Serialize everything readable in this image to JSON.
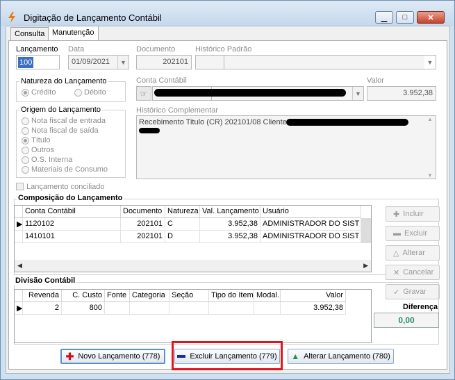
{
  "window": {
    "title": "Digitação de Lançamento Contábil",
    "controls": {
      "minimize": "▁",
      "maximize": "□",
      "close": "✕"
    }
  },
  "tabs": [
    {
      "label": "Consulta"
    },
    {
      "label": "Manutenção"
    }
  ],
  "header": {
    "lancamento_label": "Lançamento",
    "lancamento_value": "100",
    "data_label": "Data",
    "data_value": "01/09/2021",
    "documento_label": "Documento",
    "documento_value": "202101",
    "historico_padrao_label": "Histórico Padrão",
    "historico_padrao_value": ""
  },
  "natureza": {
    "title": "Natureza do Lançamento",
    "options": [
      "Crédito",
      "Débito"
    ],
    "selected": "Crédito"
  },
  "conta": {
    "label": "Conta Contábil",
    "valor_label": "Valor",
    "valor_value": "3.952,38"
  },
  "origem": {
    "title": "Origem do Lançamento",
    "options": [
      "Nota fiscal de entrada",
      "Nota fiscal de saída",
      "Título",
      "Outros",
      "O.S. Interna",
      "Materiais de Consumo"
    ],
    "selected": "Título"
  },
  "historico_complementar": {
    "label": "Histórico Complementar",
    "text": "Recebimento Titulo (CR) 202101/08 Cliente A"
  },
  "conciliado": {
    "label": "Lançamento conciliado",
    "checked": false
  },
  "composicao": {
    "title": "Composição do Lançamento",
    "columns": [
      "Conta Contábil",
      "Documento",
      "Natureza",
      "Val. Lançamento",
      "Usuário"
    ],
    "rows": [
      [
        "1120102",
        "202101",
        "C",
        "3.952,38",
        "ADMINISTRADOR DO SIST"
      ],
      [
        "1410101",
        "202101",
        "D",
        "3.952,38",
        "ADMINISTRADOR DO SIST"
      ]
    ]
  },
  "side_buttons": [
    {
      "label": "Incluir",
      "icon": "plus-icon"
    },
    {
      "label": "Excluir",
      "icon": "minus-icon"
    },
    {
      "label": "Alterar",
      "icon": "triangle-up-icon"
    },
    {
      "label": "Cancelar",
      "icon": "cross-icon"
    },
    {
      "label": "Gravar",
      "icon": "check-icon"
    }
  ],
  "divisao": {
    "title": "Divisão Contábil",
    "columns": [
      "Revenda",
      "C. Custo",
      "Fonte",
      "Categoria",
      "Seção",
      "Tipo do Item",
      "Modal.",
      "Valor"
    ],
    "rows": [
      [
        "2",
        "800",
        "",
        "",
        "",
        "",
        "",
        "3.952,38"
      ]
    ]
  },
  "diferenca": {
    "label": "Diferença",
    "value": "0,00"
  },
  "bottom_buttons": {
    "novo": "Novo Lançamento (778)",
    "excluir": "Excluir Lançamento (779)",
    "alterar": "Alterar Lançamento (780)"
  },
  "colors": {
    "highlight": "#e0151b",
    "diferenca_value": "#2a8a6a",
    "novo_icon": "#d0101a",
    "excluir_icon": "#1a2aa0",
    "alterar_icon": "#2a8a3a"
  }
}
